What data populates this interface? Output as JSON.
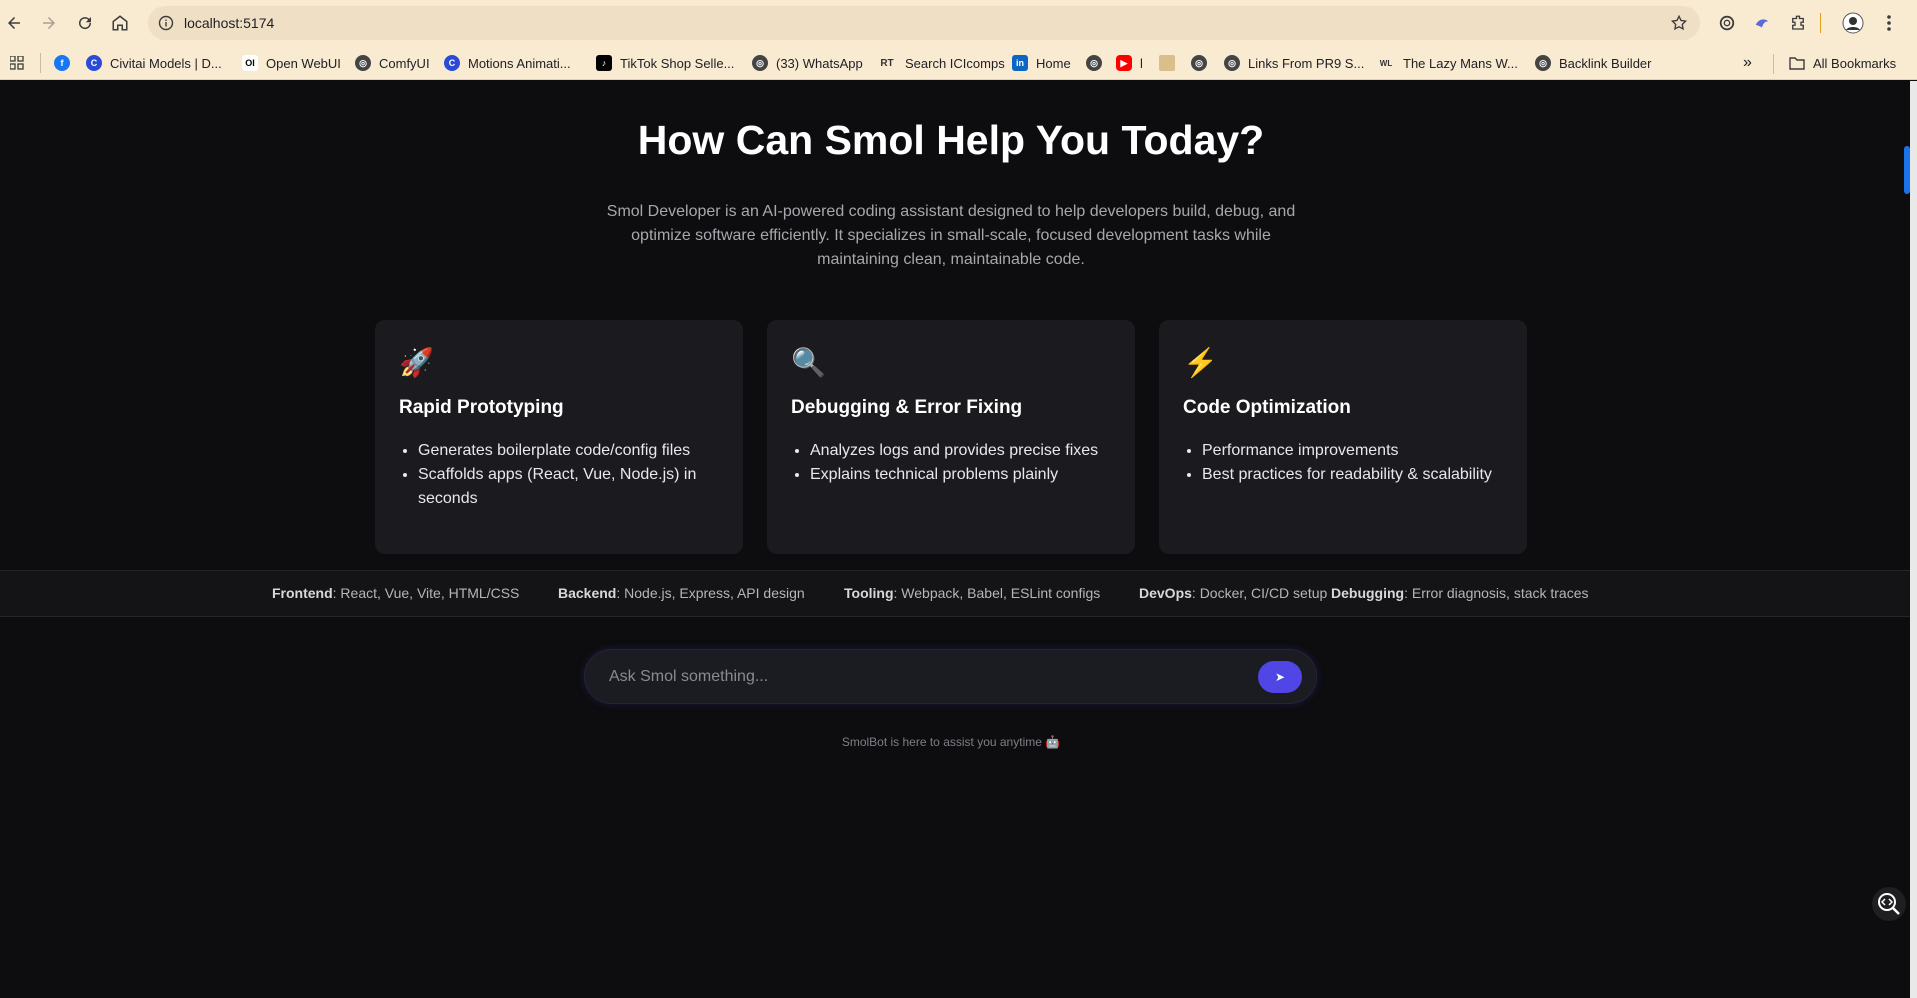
{
  "browser": {
    "url": "localhost:5174",
    "bookmarks": [
      {
        "label": "",
        "icon": "facebook-icon"
      },
      {
        "label": "Civitai Models | D...",
        "icon": "civitai-icon"
      },
      {
        "label": "Open WebUI",
        "icon": "openwebui-icon"
      },
      {
        "label": "ComfyUI",
        "icon": "globe-icon"
      },
      {
        "label": "Motions Animati...",
        "icon": "civitai-icon"
      },
      {
        "label": "TikTok Shop Selle...",
        "icon": "tiktok-icon"
      },
      {
        "label": "(33) WhatsApp",
        "icon": "globe-icon"
      },
      {
        "label": "Search ICIcomps",
        "icon": "rt-icon"
      },
      {
        "label": "Home",
        "icon": "linkedin-icon"
      },
      {
        "label": "",
        "icon": "globe-icon"
      },
      {
        "label": "l",
        "icon": "youtube-icon"
      },
      {
        "label": "",
        "icon": "image-icon"
      },
      {
        "label": "",
        "icon": "globe-icon"
      },
      {
        "label": "Links From PR9 S...",
        "icon": "globe-icon"
      },
      {
        "label": "The Lazy Mans W...",
        "icon": "wl-icon"
      },
      {
        "label": "Backlink Builder",
        "icon": "globe-icon"
      }
    ],
    "all_bookmarks": "All Bookmarks"
  },
  "hero": {
    "title": "How Can Smol Help You Today?",
    "description": "Smol Developer is an AI-powered coding assistant designed to help developers build, debug, and optimize software efficiently. It specializes in small-scale, focused development tasks while maintaining clean, maintainable code."
  },
  "cards": [
    {
      "emoji": "🚀",
      "title": "Rapid Prototyping",
      "items": [
        "Generates boilerplate code/config files",
        "Scaffolds apps (React, Vue, Node.js) in seconds"
      ]
    },
    {
      "emoji": "🔍",
      "title": "Debugging & Error Fixing",
      "items": [
        "Analyzes logs and provides precise fixes",
        "Explains technical problems plainly"
      ]
    },
    {
      "emoji": "⚡",
      "title": "Code Optimization",
      "items": [
        "Performance improvements",
        "Best practices for readability & scalability"
      ]
    }
  ],
  "skills": [
    {
      "name": "Frontend",
      "desc": ": React, Vue, Vite, HTML/CSS"
    },
    {
      "name": "Backend",
      "desc": ": Node.js, Express, API design"
    },
    {
      "name": "Tooling",
      "desc": ": Webpack, Babel, ESLint configs"
    },
    {
      "name": "DevOps",
      "desc": ": Docker, CI/CD setup"
    },
    {
      "name": "Debugging",
      "desc": ": Error diagnosis, stack traces"
    }
  ],
  "chat": {
    "placeholder": "Ask Smol something...",
    "send_label": "➤"
  },
  "footer": "SmolBot is here to assist you anytime 🤖",
  "colors": {
    "background": "#0d0d0f",
    "card": "#1b1b1f",
    "accent": "#4f46e5",
    "chrome": "#f9ead2"
  }
}
